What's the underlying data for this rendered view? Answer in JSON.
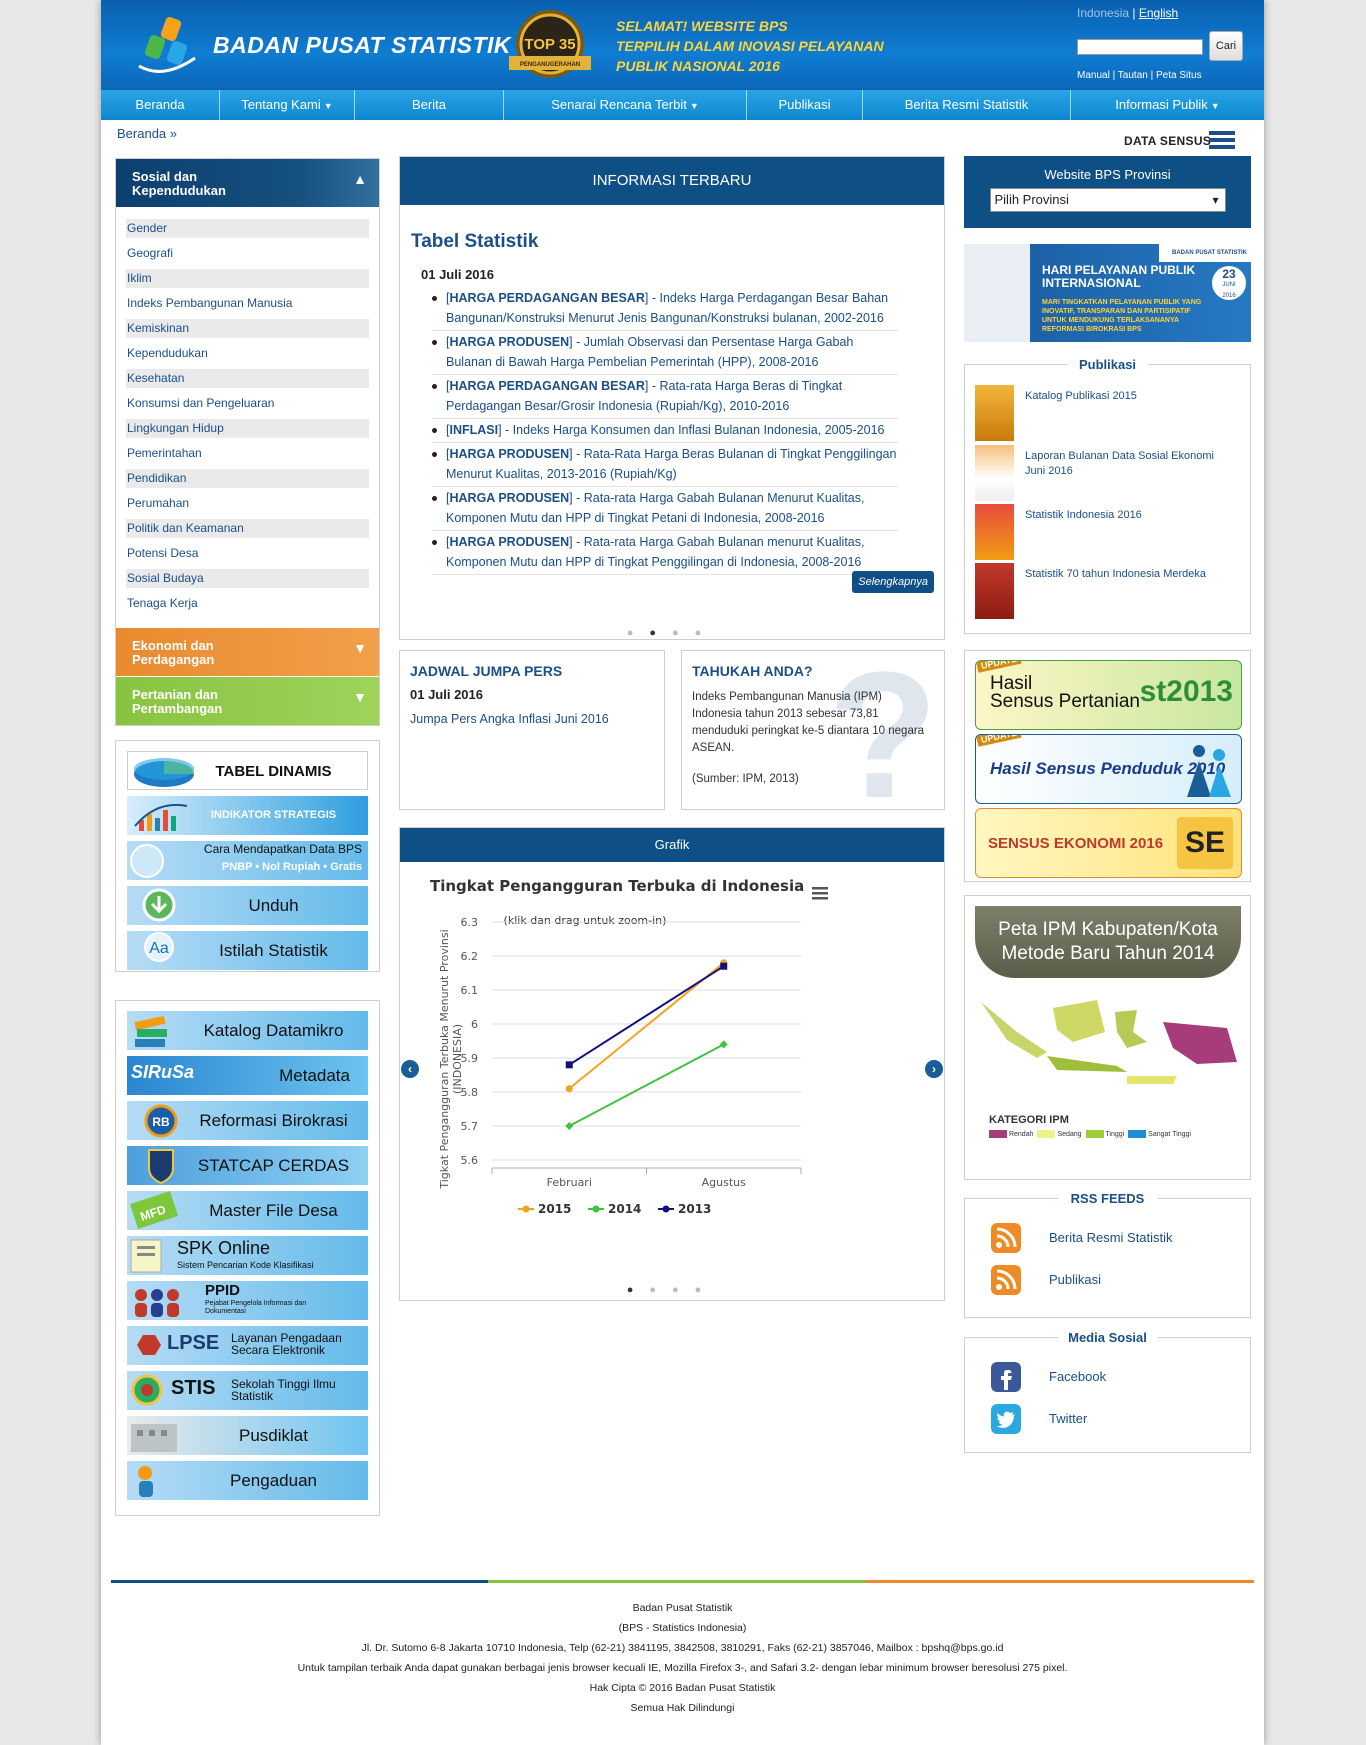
{
  "header": {
    "logo_text": "BADAN PUSAT STATISTIK",
    "award_top": "TOP 35",
    "award_ribbon": "PENGANUGERAHAN",
    "award_lines": [
      "SELAMAT! WEBSITE BPS",
      "TERPILIH DALAM INOVASI PELAYANAN",
      "PUBLIK NASIONAL 2016"
    ],
    "lang_id": "Indonesia",
    "lang_sep": " | ",
    "lang_en": "English",
    "search_button": "Cari",
    "top_links": [
      "Manual",
      "Tautan",
      "Peta Situs"
    ]
  },
  "nav": [
    {
      "label": "Beranda",
      "caret": false
    },
    {
      "label": "Tentang Kami",
      "caret": true
    },
    {
      "label": "Berita",
      "caret": false
    },
    {
      "label": "Senarai Rencana Terbit",
      "caret": true
    },
    {
      "label": "Publikasi",
      "caret": false
    },
    {
      "label": "Berita Resmi Statistik",
      "caret": false
    },
    {
      "label": "Informasi Publik",
      "caret": true
    }
  ],
  "breadcrumb": "Beranda »",
  "data_sensus": "DATA SENSUS",
  "sidebar": {
    "cat_social": "Sosial dan Kependudukan",
    "cat_social_l1": "Sosial dan",
    "cat_social_l2": "Kependudukan",
    "social_items": [
      "Gender",
      "Geografi",
      "Iklim",
      "Indeks Pembangunan Manusia",
      "Kemiskinan",
      "Kependudukan",
      "Kesehatan",
      "Konsumsi dan Pengeluaran",
      "Lingkungan Hidup",
      "Pemerintahan",
      "Pendidikan",
      "Perumahan",
      "Politik dan Keamanan",
      "Potensi Desa",
      "Sosial Budaya",
      "Tenaga Kerja"
    ],
    "cat_econ_l1": "Ekonomi dan",
    "cat_econ_l2": "Perdagangan",
    "cat_agri_l1": "Pertanian dan",
    "cat_agri_l2": "Pertambangan",
    "banners1": [
      "TABEL DINAMIS",
      "INDIKATOR STRATEGIS",
      "Cara Mendapatkan Data BPS",
      "Unduh",
      "Istilah Statistik"
    ],
    "pnbp_text": "PNBP • Nol Rupiah • Gratis",
    "banners2": [
      "Katalog Datamikro",
      "Metadata",
      "Reformasi Birokrasi",
      "STATCAP CERDAS",
      "Master File Desa",
      "SPK Online",
      "PPID",
      "LPSE",
      "STIS",
      "Pusdiklat",
      "Pengaduan"
    ],
    "sirusa": "SIRuSa",
    "spk_sub": "Sistem Pencarian Kode Klasifikasi",
    "ppid_sub": "Pejabat Pengelola Informasi dan Dokumentasi",
    "lpse_sub": "Layanan Pengadaan Secara Elektronik",
    "stis_sub": "Sekolah Tinggi Ilmu Statistik",
    "mfd": "MFD"
  },
  "info": {
    "header": "INFORMASI TERBARU",
    "title": "Tabel Statistik",
    "date": "01 Juli 2016",
    "items": [
      {
        "tag": "HARGA PERDAGANGAN BESAR",
        "text": " - Indeks Harga Perdagangan Besar Bahan Bangunan/Konstruksi Menurut Jenis Bangunan/Konstruksi bulanan, 2002-2016"
      },
      {
        "tag": "HARGA PRODUSEN",
        "text": " - Jumlah Observasi dan Persentase Harga Gabah Bulanan di Bawah Harga Pembelian Pemerintah (HPP), 2008-2016"
      },
      {
        "tag": "HARGA PERDAGANGAN BESAR",
        "text": " - Rata-rata Harga Beras di Tingkat Perdagangan Besar/Grosir Indonesia (Rupiah/Kg), 2010-2016"
      },
      {
        "tag": "INFLASI",
        "text": " - Indeks Harga Konsumen dan Inflasi Bulanan Indonesia, 2005-2016"
      },
      {
        "tag": "HARGA PRODUSEN",
        "text": " - Rata-Rata Harga Beras Bulanan di Tingkat Penggilingan Menurut Kualitas, 2013-2016 (Rupiah/Kg)"
      },
      {
        "tag": "HARGA PRODUSEN",
        "text": " - Rata-rata Harga Gabah Bulanan Menurut Kualitas, Komponen Mutu dan HPP di Tingkat Petani di Indonesia, 2008-2016"
      },
      {
        "tag": "HARGA PRODUSEN",
        "text": " - Rata-rata Harga Gabah Bulanan menurut Kualitas, Komponen Mutu dan HPP di Tingkat Penggilingan di Indonesia, 2008-2016"
      }
    ],
    "more": "Selengkapnya"
  },
  "jadwal": {
    "title": "JADWAL JUMPA PERS",
    "date": "01 Juli 2016",
    "link": "Jumpa Pers Angka Inflasi Juni 2016"
  },
  "tahukah": {
    "title": "TAHUKAH ANDA?",
    "text": "Indeks Pembangunan Manusia (IPM) Indonesia tahun 2013 sebesar 73,81 menduduki peringkat ke-5 diantara 10 negara ASEAN.",
    "source": "(Sumber: IPM, 2013)"
  },
  "grafik": {
    "header": "Grafik"
  },
  "chart_data": {
    "type": "line",
    "title": "Tingkat Pengangguran Terbuka di Indonesia",
    "subtitle": "(klik dan drag untuk zoom-in)",
    "ylabel_l1": "Tigkat Pengangguran Terbuka Menurut Provinsi",
    "ylabel_l2": "(INDONESIA)",
    "categories": [
      "Februari",
      "Agustus"
    ],
    "yticks": [
      "6.3",
      "6.2",
      "6.1",
      "6",
      "5.9",
      "5.8",
      "5.7",
      "5.6"
    ],
    "ylim": [
      5.6,
      6.3
    ],
    "series": [
      {
        "name": "2015",
        "values": [
          5.81,
          6.18
        ],
        "color": "#f7a21b"
      },
      {
        "name": "2014",
        "values": [
          5.7,
          5.94
        ],
        "color": "#3fc43f"
      },
      {
        "name": "2013",
        "values": [
          5.88,
          6.17
        ],
        "color": "#101080"
      }
    ],
    "legend": "bottom"
  },
  "right": {
    "prov_title": "Website BPS Provinsi",
    "prov_select": "Pilih Provinsi",
    "hpp_l1": "HARI PELAYANAN PUBLIK",
    "hpp_l2": "INTERNASIONAL",
    "hpp_l3": "MARI TINGKATKAN PELAYANAN PUBLIK YANG INOVATIF, TRANSPARAN DAN PARTISIPATIF UNTUK MENDUKUNG TERLAKSANANYA REFORMASI BIROKRASI BPS",
    "hpp_day": "23",
    "hpp_month": "JUNI",
    "hpp_year": "2016",
    "hpp_org": "BADAN PUSAT STATISTIK",
    "publikasi_title": "Publikasi",
    "publikasi": [
      "Katalog Publikasi 2015",
      "Laporan Bulanan Data Sosial Ekonomi Juni 2016",
      "Statistik Indonesia 2016",
      "Statistik 70 tahun Indonesia Merdeka"
    ],
    "sensus": [
      {
        "update": "UPDATE",
        "l1": "Hasil",
        "l2": "Sensus Pertanian",
        "mark": "st2013"
      },
      {
        "update": "UPDATE",
        "l1": "Hasil Sensus Penduduk 2010",
        "l2": "",
        "mark": ""
      },
      {
        "update": "",
        "l1": "SENSUS EKONOMI 2016",
        "l2": "",
        "mark": "SE"
      }
    ],
    "ipm_title_l1": "Peta IPM Kabupaten/Kota",
    "ipm_title_l2": "Metode Baru Tahun 2014",
    "ipm_kategori": "KATEGORI IPM",
    "ipm_legend": [
      "Rendah",
      "Sedang",
      "Tinggi",
      "Sangat Tinggi"
    ],
    "rss_title": "RSS FEEDS",
    "rss": [
      "Berita Resmi Statistik",
      "Publikasi"
    ],
    "medsos_title": "Media Sosial",
    "medsos": [
      "Facebook",
      "Twitter"
    ]
  },
  "footer": [
    "Badan Pusat Statistik",
    "(BPS - Statistics Indonesia)",
    "Jl. Dr. Sutomo 6-8 Jakarta 10710 Indonesia, Telp (62-21) 3841195, 3842508, 3810291, Faks (62-21) 3857046, Mailbox : bpshq@bps.go.id",
    "Untuk tampilan terbaik Anda dapat gunakan berbagai jenis browser kecuali IE, Mozilla Firefox 3-, and Safari 3.2- dengan lebar minimum browser beresolusi 275 pixel.",
    "Hak Cipta © 2016 Badan Pusat Statistik",
    "Semua Hak Dilindungi"
  ]
}
